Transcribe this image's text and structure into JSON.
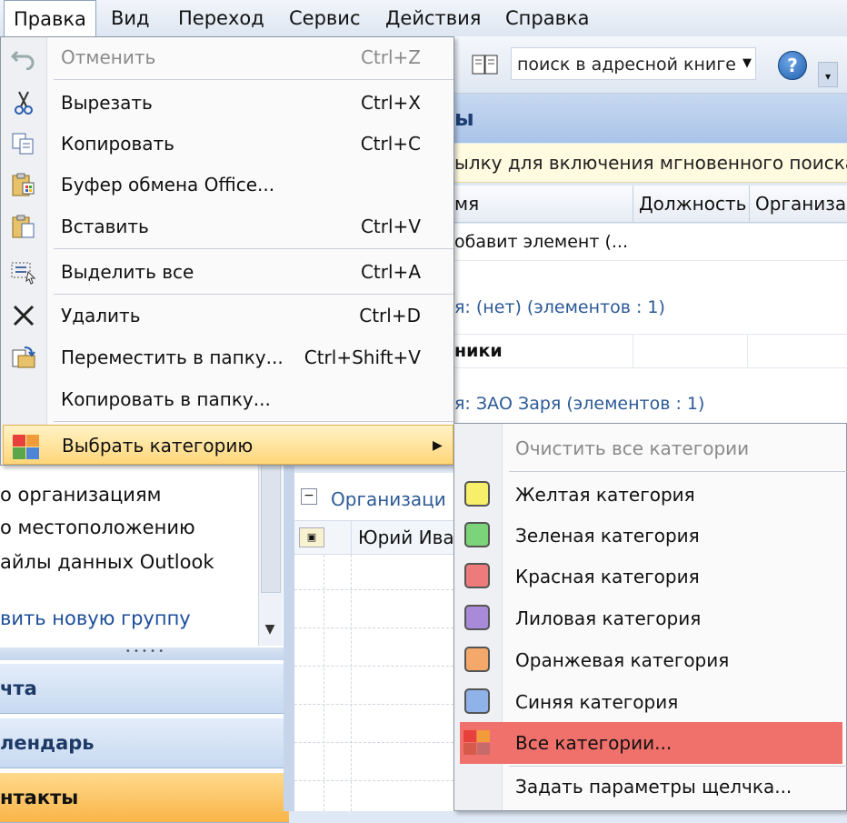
{
  "menubar": {
    "items": [
      {
        "label": "Правка",
        "active": true
      },
      {
        "label": "Вид"
      },
      {
        "label": "Переход"
      },
      {
        "label": "Сервис"
      },
      {
        "label": "Действия"
      },
      {
        "label": "Справка"
      }
    ]
  },
  "toolbar": {
    "search_placeholder": "поиск в адресной книге",
    "help_label": "?"
  },
  "contacts": {
    "title": "ы",
    "info_bar": "ылку для включения мгновенного поиска",
    "columns": [
      "мя",
      "Должность",
      "Организа"
    ],
    "add_row": "обавит элемент (...",
    "group1": "я: (нет) (элементов : 1)",
    "group1_row": "ники",
    "group2": "я: ЗАО Заря (элементов : 1)",
    "card_group": "Организаци",
    "card_row": "Юрий Ива"
  },
  "nav": {
    "links": [
      "о организациям",
      "о местоположению",
      "айлы данных Outlook"
    ],
    "add_group": "вить новую группу",
    "buttons": [
      {
        "label": "чта",
        "active": false
      },
      {
        "label": "лендарь",
        "active": false
      },
      {
        "label": "нтакты",
        "active": true
      }
    ]
  },
  "edit_menu": {
    "items": [
      {
        "icon": "undo-icon",
        "label": "Отменить",
        "shortcut": "Ctrl+Z",
        "disabled": true
      },
      {
        "icon": "cut-icon",
        "label": "Вырезать",
        "shortcut": "Ctrl+X"
      },
      {
        "icon": "copy-icon",
        "label": "Копировать",
        "shortcut": "Ctrl+C"
      },
      {
        "icon": "office-clipboard-icon",
        "label": "Буфер обмена Office...",
        "shortcut": ""
      },
      {
        "icon": "paste-icon",
        "label": "Вставить",
        "shortcut": "Ctrl+V"
      },
      {
        "icon": "select-all-icon",
        "label": "Выделить все",
        "shortcut": "Ctrl+A"
      },
      {
        "icon": "delete-icon",
        "label": "Удалить",
        "shortcut": "Ctrl+D"
      },
      {
        "icon": "move-to-folder-icon",
        "label": "Переместить в папку...",
        "shortcut": "Ctrl+Shift+V"
      },
      {
        "icon": "",
        "label": "Копировать в папку...",
        "shortcut": ""
      },
      {
        "icon": "categorize-icon",
        "label": "Выбрать категорию",
        "shortcut": "",
        "highlighted": true
      }
    ]
  },
  "category_menu": {
    "clear_all": "Очистить все категории",
    "categories": [
      {
        "label": "Желтая категория",
        "color": "#f7ef6a"
      },
      {
        "label": "Зеленая категория",
        "color": "#7bd47a"
      },
      {
        "label": "Красная категория",
        "color": "#ee7b7b"
      },
      {
        "label": "Лиловая категория",
        "color": "#a88ad8"
      },
      {
        "label": "Оранжевая категория",
        "color": "#f4a96a"
      },
      {
        "label": "Синяя категория",
        "color": "#8fb3e8"
      }
    ],
    "all_categories": "Все категории...",
    "quick_click": "Задать параметры щелчка..."
  }
}
